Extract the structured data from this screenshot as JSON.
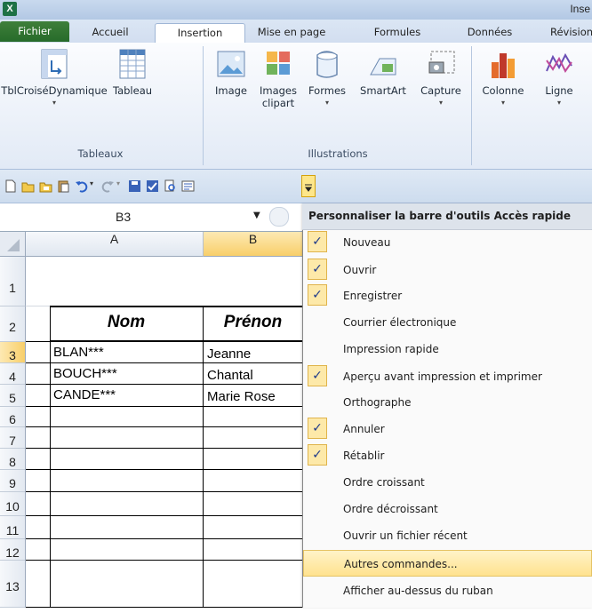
{
  "window": {
    "title": "Inse",
    "app_icon": "X"
  },
  "tabs": [
    "Fichier",
    "Accueil",
    "Insertion",
    "Mise en page",
    "Formules",
    "Données",
    "Révision"
  ],
  "ribbon": {
    "tableaux": {
      "pivot": "TblCroiséDynamique",
      "table": "Tableau",
      "label": "Tableaux"
    },
    "illustrations": {
      "image": "Image",
      "clipart_line1": "Images",
      "clipart_line2": "clipart",
      "shapes": "Formes",
      "smartart": "SmartArt",
      "capture": "Capture",
      "label": "Illustrations"
    },
    "charts": {
      "column": "Colonne",
      "line": "Ligne"
    }
  },
  "namebox": "B3",
  "columns": [
    "A",
    "B"
  ],
  "rows": [
    "1",
    "2",
    "3",
    "4",
    "5",
    "6",
    "7",
    "8",
    "9",
    "10",
    "11",
    "12",
    "13"
  ],
  "headers": {
    "nom": "Nom",
    "prenom": "Prénon"
  },
  "cells": [
    {
      "a": "BLAN***",
      "b": "Jeanne"
    },
    {
      "a": "BOUCH***",
      "b": "Chantal"
    },
    {
      "a": "CANDE***",
      "b": "Marie Rose"
    }
  ],
  "menu": {
    "title": "Personnaliser la barre d'outils Accès rapide",
    "check": "✓",
    "items": [
      {
        "label": "Nouveau",
        "checked": true
      },
      {
        "label": "Ouvrir",
        "checked": true
      },
      {
        "label": "Enregistrer",
        "checked": true
      },
      {
        "label": "Courrier électronique",
        "checked": false
      },
      {
        "label": "Impression rapide",
        "checked": false
      },
      {
        "label": "Aperçu avant impression et imprimer",
        "checked": true
      },
      {
        "label": "Orthographe",
        "checked": false
      },
      {
        "label": "Annuler",
        "checked": true
      },
      {
        "label": "Rétablir",
        "checked": true
      },
      {
        "label": "Ordre croissant",
        "checked": false
      },
      {
        "label": "Ordre décroissant",
        "checked": false
      },
      {
        "label": "Ouvrir un fichier récent",
        "checked": false
      },
      {
        "label": "Autres commandes...",
        "checked": false
      },
      {
        "label": "Afficher au-dessus du ruban",
        "checked": false
      }
    ]
  }
}
